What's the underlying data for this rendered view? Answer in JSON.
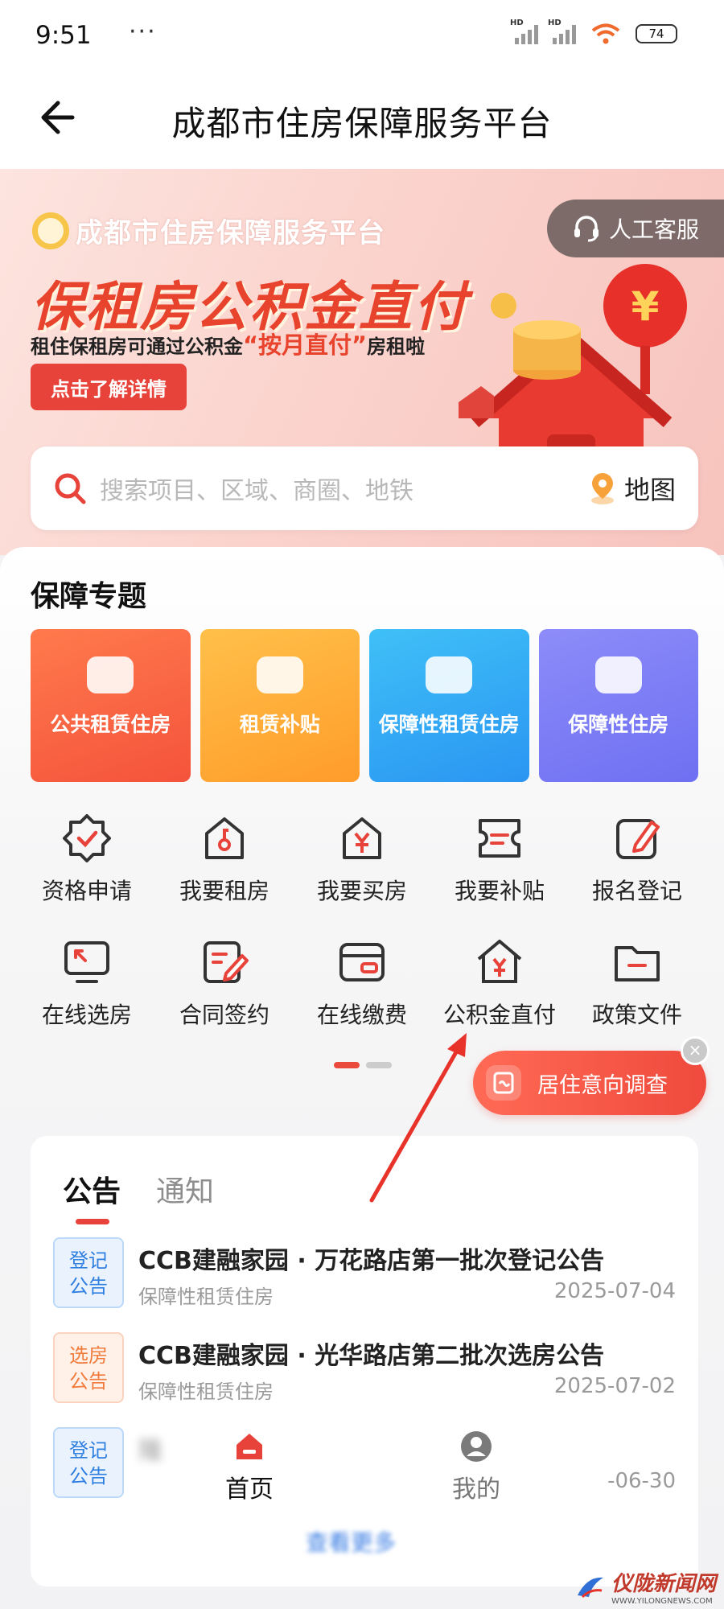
{
  "status_bar": {
    "time": "9:51",
    "more": "···",
    "battery": "74",
    "signal_label": "HD"
  },
  "header": {
    "title": "成都市住房保障服务平台"
  },
  "banner": {
    "brand": "成都市住房保障服务平台",
    "headline": "保租房公积金直付",
    "sub_prefix": "租住保租房可通过公积金",
    "sub_highlight": "“按月直付”",
    "sub_suffix": "房租啦",
    "detail_button": "点击了解详情",
    "customer_service": "人工客服"
  },
  "search": {
    "placeholder": "搜索项目、区域、商圈、地铁",
    "map_label": "地图"
  },
  "topics": {
    "title": "保障专题",
    "cards": [
      "公共租赁住房",
      "租赁补贴",
      "保障性租赁住房",
      "保障性住房"
    ]
  },
  "services": [
    [
      "资格申请",
      "我要租房",
      "我要买房",
      "我要补贴",
      "报名登记"
    ],
    [
      "在线选房",
      "合同签约",
      "在线缴费",
      "公积金直付",
      "政策文件"
    ]
  ],
  "survey": {
    "label": "居住意向调查",
    "close": "×"
  },
  "notices": {
    "tabs": [
      "公告",
      "通知"
    ],
    "items": [
      {
        "badge": "登记\n公告",
        "badge_l1": "登记",
        "badge_l2": "公告",
        "title": "CCB建融家园 · 万花路店第一批次登记公告",
        "category": "保障性租赁住房",
        "date": "2025-07-04"
      },
      {
        "badge_l1": "选房",
        "badge_l2": "公告",
        "title": "CCB建融家园 · 光华路店第二批次选房公告",
        "category": "保障性租赁住房",
        "date": "2025-07-02"
      },
      {
        "badge_l1": "登记",
        "badge_l2": "公告",
        "title": "隆",
        "category": "",
        "date": "-06-30"
      }
    ],
    "view_more": "查看更多"
  },
  "bottom_nav": {
    "home": "首页",
    "mine": "我的"
  },
  "watermark": {
    "name": "仪陇新闻网",
    "url": "WWW.YILONGNEWS.COM"
  },
  "colors": {
    "accent": "#e8433a",
    "blue": "#2f7fe0",
    "orange": "#f07b3c"
  }
}
